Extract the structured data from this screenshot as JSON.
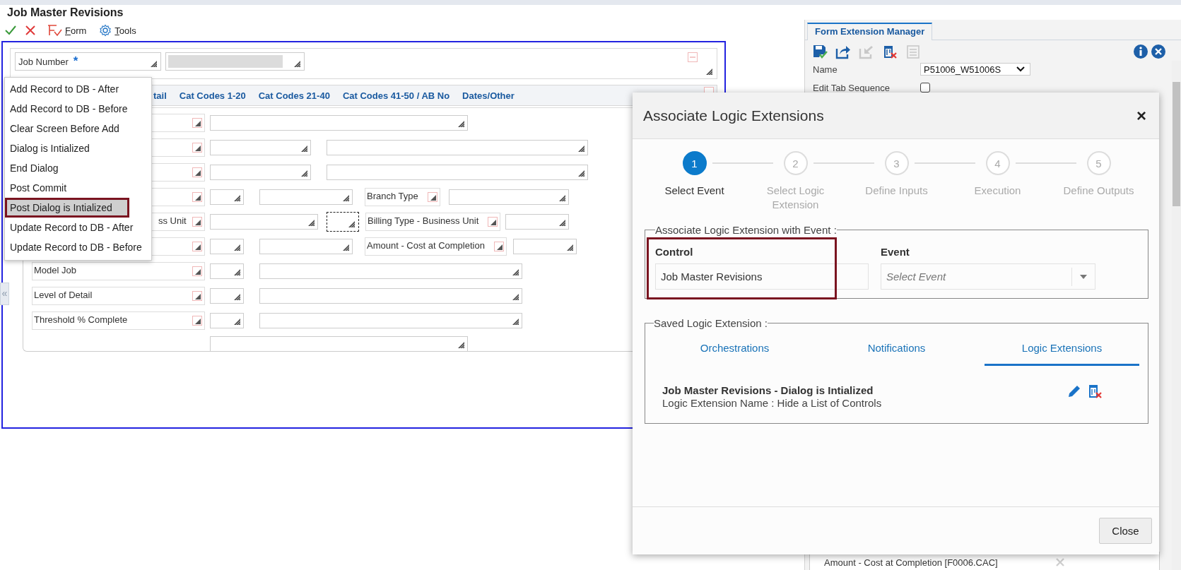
{
  "window": {
    "title": "Job Master Revisions"
  },
  "toolbar": {
    "form_label": "Form",
    "tools_label": "Tools"
  },
  "header": {
    "job_number_label": "Job Number",
    "required_mark": "*"
  },
  "form_tabs": [
    {
      "label": "tail"
    },
    {
      "label": "Cat Codes 1-20"
    },
    {
      "label": "Cat Codes 21-40"
    },
    {
      "label": "Cat Codes 41-50 / AB No"
    },
    {
      "label": "Dates/Other"
    }
  ],
  "form_rows": [
    {
      "kind": "wide"
    },
    {
      "kind": "pair"
    },
    {
      "kind": "pair"
    },
    {
      "kind": "side",
      "side_label": "Branch Type"
    },
    {
      "kind": "unit",
      "label": "ss Unit",
      "side_label": "Billing Type - Business Unit"
    },
    {
      "kind": "side",
      "side_label": "Amount - Cost at Completion"
    },
    {
      "kind": "long",
      "label": "Model Job"
    },
    {
      "kind": "long",
      "label": "Level of Detail"
    },
    {
      "kind": "long",
      "label": "Threshold % Complete"
    },
    {
      "kind": "bottom"
    }
  ],
  "collapse_handle": "«",
  "event_menu": {
    "items": [
      {
        "label": "Add Record to DB - After",
        "selected": false
      },
      {
        "label": "Add Record to DB - Before",
        "selected": false
      },
      {
        "label": "Clear Screen Before Add",
        "selected": false
      },
      {
        "label": "Dialog is Intialized",
        "selected": false
      },
      {
        "label": "End Dialog",
        "selected": false
      },
      {
        "label": "Post Commit",
        "selected": false
      },
      {
        "label": "Post Dialog is Intialized",
        "selected": true
      },
      {
        "label": "Update Record to DB - After",
        "selected": false
      },
      {
        "label": "Update Record to DB - Before",
        "selected": false
      }
    ]
  },
  "side_panel": {
    "tab": "Form Extension Manager",
    "name_label": "Name",
    "name_value": "P51006_W51006S",
    "tab_sequence_label": "Edit Tab Sequence",
    "tab_sequence_checked": false,
    "list_item": "Amount - Cost at Completion [F0006.CAC]"
  },
  "modal": {
    "title": "Associate Logic Extensions",
    "close_glyph": "×",
    "steps": [
      {
        "number": "1",
        "label": "Select Event",
        "selected": true
      },
      {
        "number": "2",
        "label": "Select Logic Extension",
        "selected": false
      },
      {
        "number": "3",
        "label": "Define Inputs",
        "selected": false
      },
      {
        "number": "4",
        "label": "Execution",
        "selected": false
      },
      {
        "number": "5",
        "label": "Define Outputs",
        "selected": false
      }
    ],
    "event_section": {
      "legend": "Associate Logic Extension with Event :",
      "control_label": "Control",
      "control_value": "Job Master Revisions",
      "event_label": "Event",
      "event_placeholder": "Select Event"
    },
    "saved_section": {
      "legend": "Saved Logic Extension :",
      "tabs": [
        {
          "label": "Orchestrations",
          "selected": false
        },
        {
          "label": "Notifications",
          "selected": false
        },
        {
          "label": "Logic Extensions",
          "selected": true
        }
      ],
      "entries": [
        {
          "title": "Job Master Revisions - Dialog is Intialized",
          "subtitle": "Logic Extension Name : Hide a List of Controls"
        }
      ]
    },
    "footer_button": "Close"
  }
}
